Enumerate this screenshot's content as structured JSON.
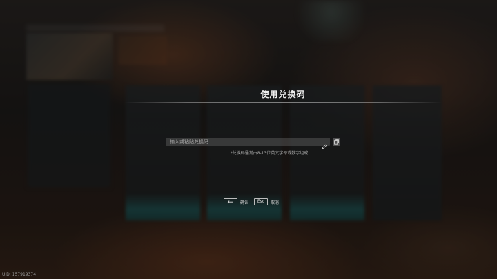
{
  "dialog": {
    "title": "使用兑换码",
    "input": {
      "placeholder": "输入或粘贴兑换码",
      "value": ""
    },
    "hint": "*兑换码通常由8-13位英文字母或数字组成",
    "actions": [
      {
        "key_label": "",
        "key_icon": "enter-key-icon",
        "label": "确认"
      },
      {
        "key_label": "Esc",
        "label": "取消"
      }
    ]
  },
  "footer": {
    "uid": "UID: 157919374"
  },
  "colors": {
    "overlay": "#080808",
    "title_text": "#ededed",
    "hint_text": "#a9a9a9",
    "input_bg": "#5a5a5a",
    "card_accent": "#1e5f5f"
  },
  "icons": [
    "pencil-icon",
    "paste-icon",
    "enter-key-icon"
  ]
}
